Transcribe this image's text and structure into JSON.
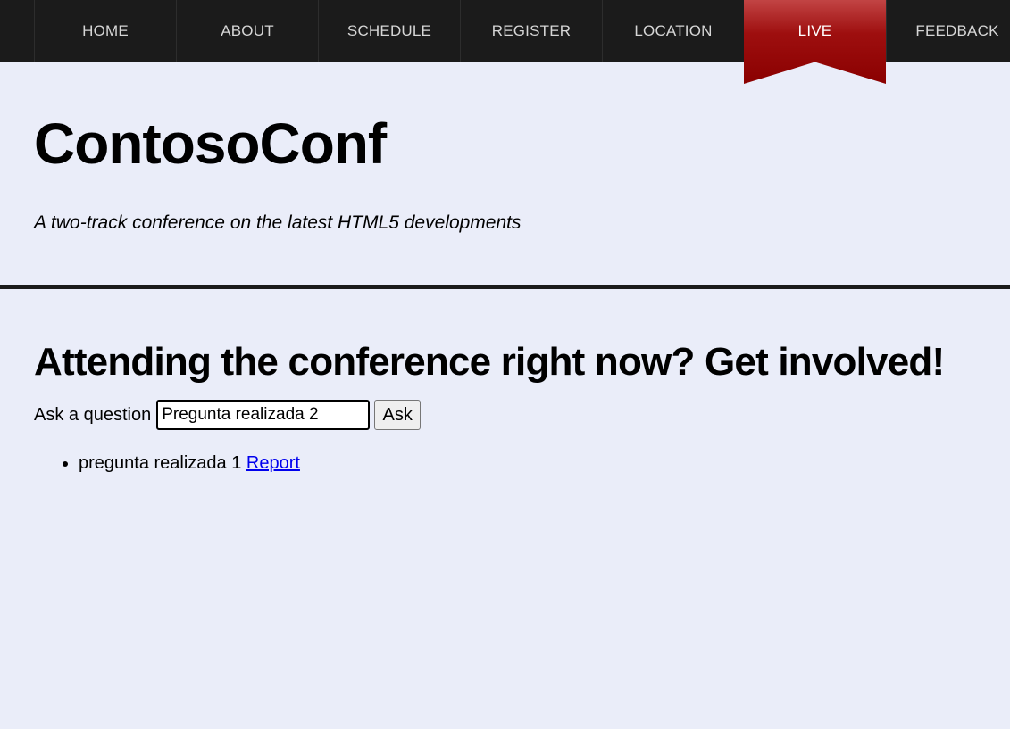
{
  "nav": {
    "items": [
      {
        "label": "HOME"
      },
      {
        "label": "ABOUT"
      },
      {
        "label": "SCHEDULE"
      },
      {
        "label": "REGISTER"
      },
      {
        "label": "LOCATION"
      },
      {
        "label": "LIVE"
      },
      {
        "label": "FEEDBACK"
      }
    ],
    "active_index": 5,
    "active_color": "#8a0000"
  },
  "header": {
    "title": "ContosoConf",
    "tagline": "A two-track conference on the latest HTML5 developments"
  },
  "main": {
    "heading": "Attending the conference right now? Get involved!",
    "ask_form": {
      "label": "Ask a question",
      "input_value": "Pregunta realizada 2",
      "button_label": "Ask"
    },
    "questions": [
      {
        "text": "pregunta realizada 1",
        "report_label": "Report"
      }
    ]
  },
  "colors": {
    "page_background": "#eaedf9",
    "navbar_background": "#1b1b1b",
    "link": "#0000ee"
  }
}
